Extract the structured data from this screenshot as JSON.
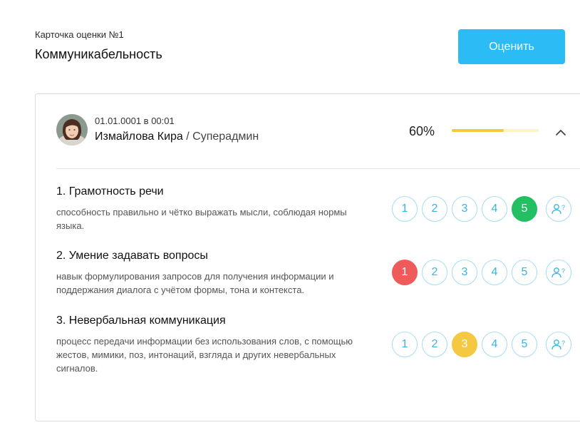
{
  "header": {
    "subtitle": "Карточка оценки №1",
    "title": "Коммуникабельность",
    "rate_button": "Оценить"
  },
  "card": {
    "date": "01.01.0001 в 00:01",
    "user_name": "Измайлова Кира",
    "user_role": "/ Суперадмин",
    "percent_label": "60%",
    "progress_fraction": 0.6,
    "collapse_icon": "chevron-up-icon"
  },
  "colors": {
    "accent": "#2bbcf5",
    "selected_green": "#22c063",
    "selected_red": "#ef5b5b",
    "selected_yellow": "#f5c842",
    "progress_fill": "#f5c842",
    "progress_track": "#fdf3c6"
  },
  "criteria": [
    {
      "title": "1. Грамотность речи",
      "description": "способность правильно и чётко выражать мысли, соблюдая нормы языка.",
      "options": [
        "1",
        "2",
        "3",
        "4",
        "5"
      ],
      "selected": 5,
      "selected_color": "green"
    },
    {
      "title": "2. Умение задавать вопросы",
      "description": "навык формулирования запросов для получения информации и поддержания диалога с учётом формы, тона и контекста.",
      "options": [
        "1",
        "2",
        "3",
        "4",
        "5"
      ],
      "selected": 1,
      "selected_color": "red"
    },
    {
      "title": "3. Невербальная коммуникация",
      "description": "процесс передачи информации без использования слов, с помощью жестов, мимики, поз, интонаций, взгляда и других невербальных сигналов.",
      "options": [
        "1",
        "2",
        "3",
        "4",
        "5"
      ],
      "selected": 3,
      "selected_color": "yellow"
    }
  ],
  "ask_icon": "user-question-icon"
}
